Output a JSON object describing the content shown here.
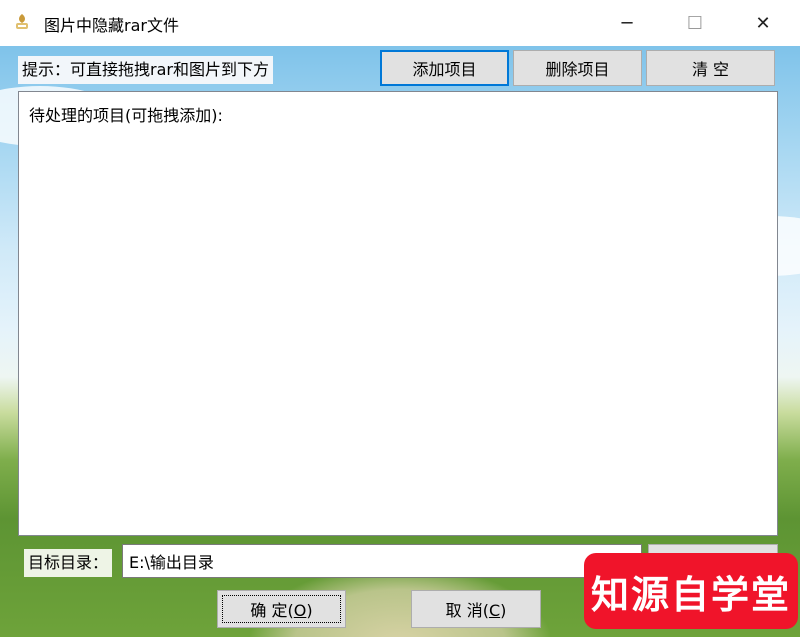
{
  "window": {
    "title": "图片中隐藏rar文件",
    "icon": "app-icon",
    "controls": {
      "minimize": "─",
      "maximize": "☐",
      "close": "✕"
    }
  },
  "hint": "提示：可直接拖拽rar和图片到下方",
  "toolbar": {
    "add_label": "添加项目",
    "delete_label": "删除项目",
    "clear_label": "清 空"
  },
  "list": {
    "header": "待处理的项目(可拖拽添加):",
    "items": []
  },
  "target": {
    "label": "目标目录：",
    "value": "E:\\输出目录"
  },
  "footer": {
    "ok_label": "确 定",
    "ok_mnemonic": "O",
    "cancel_label": "取 消",
    "cancel_mnemonic": "C"
  },
  "watermark": "知源自学堂",
  "colors": {
    "accent": "#0078d7",
    "watermark_bg": "#f0142a",
    "button_face": "#e1e1e1"
  }
}
